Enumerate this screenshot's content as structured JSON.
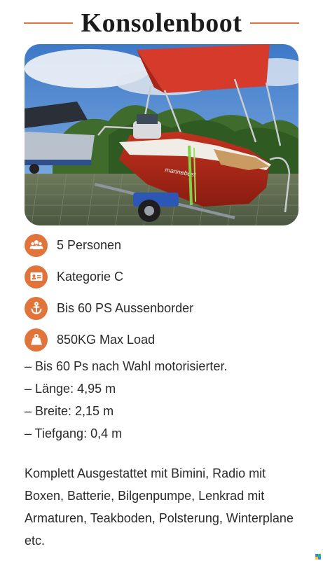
{
  "page": {
    "title": "Konsolenboot",
    "accent_color": "#e0743a"
  },
  "photo": {
    "hull_lettering": "marinebest"
  },
  "features": [
    {
      "icon": "people-group-icon",
      "label": "5 Personen"
    },
    {
      "icon": "id-card-icon",
      "label": "Kategorie C"
    },
    {
      "icon": "anchor-icon",
      "label": "Bis 60 PS Aussenborder"
    },
    {
      "icon": "weight-icon",
      "label": "850KG Max Load"
    }
  ],
  "specs": [
    "– Bis 60 Ps nach Wahl motorisierter.",
    "– Länge: 4,95 m",
    "– Breite: 2,15 m",
    "– Tiefgang: 0,4 m"
  ],
  "description": "Komplett Ausgestattet mit Bimini, Radio mit Boxen, Batterie, Bilgenpumpe, Lenkrad mit Armaturen, Teakboden, Polsterung, Winterplane etc."
}
